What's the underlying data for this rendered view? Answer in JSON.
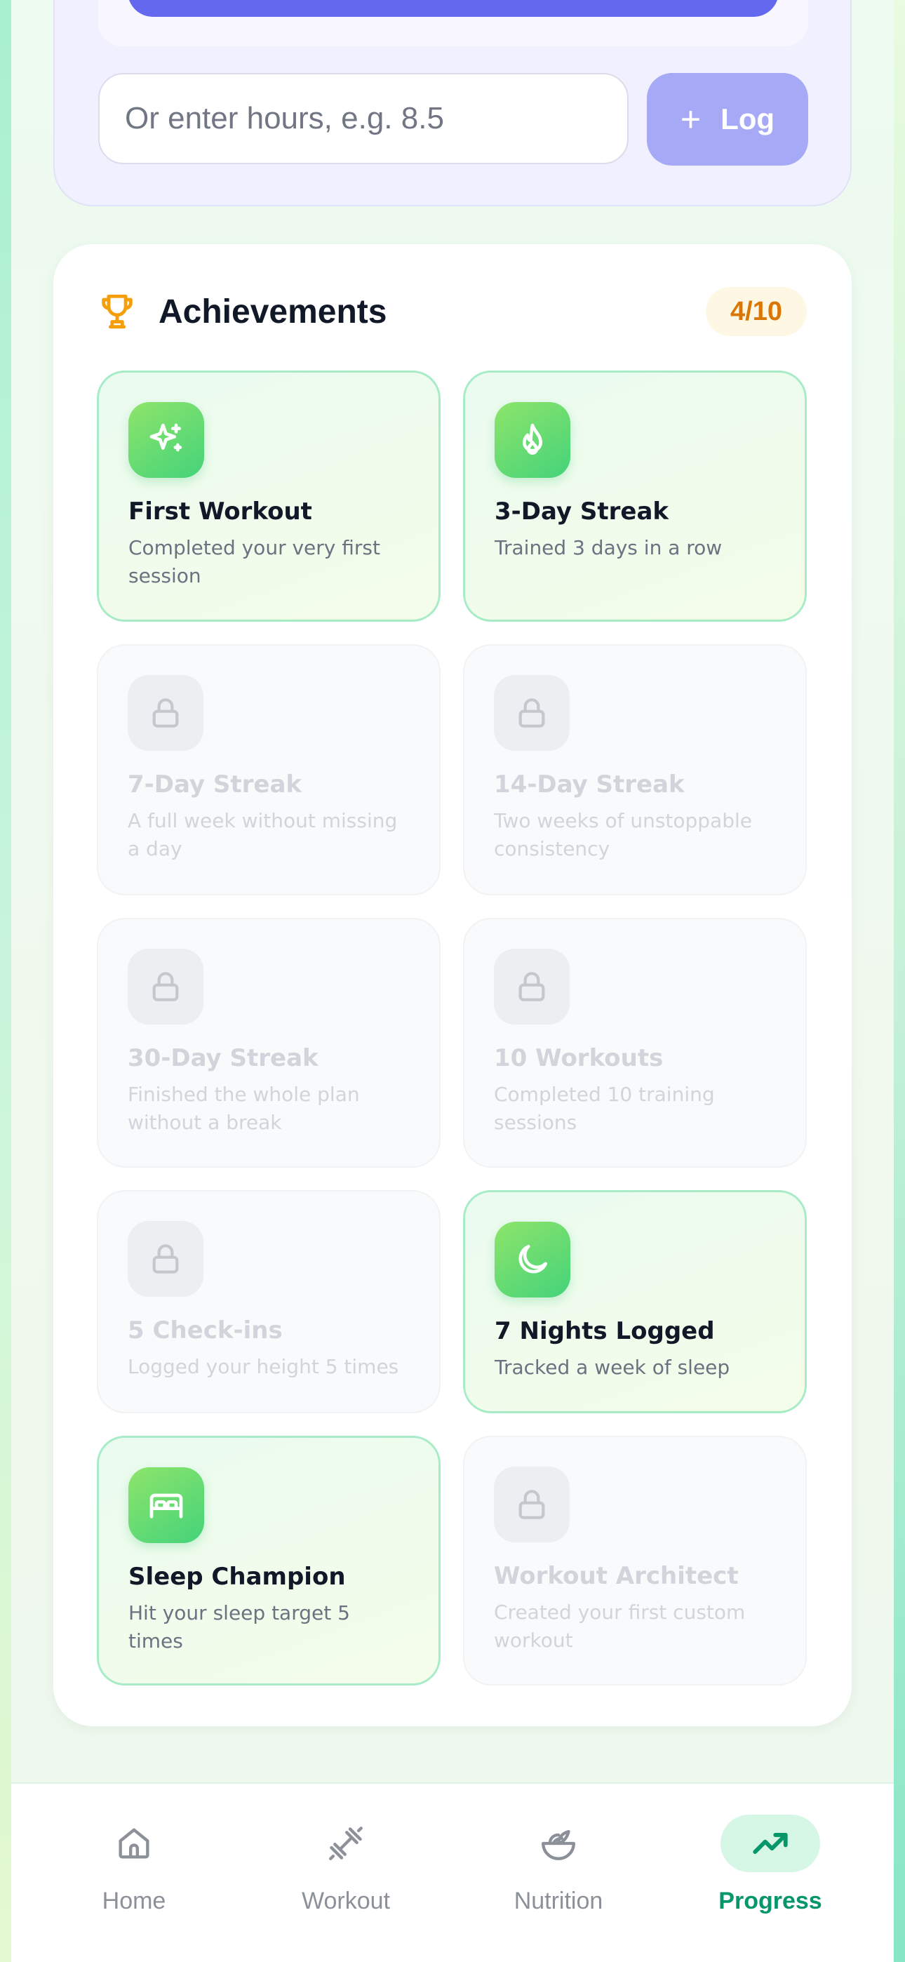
{
  "sleep": {
    "hours_placeholder": "Or enter hours, e.g. 8.5",
    "log_plus": "+",
    "log_label": "Log"
  },
  "achievements": {
    "title": "Achievements",
    "count": "4/10",
    "items": [
      {
        "name": "First Workout",
        "desc": "Completed your very first session",
        "earned": true,
        "icon": "sparkles-icon"
      },
      {
        "name": "3-Day Streak",
        "desc": "Trained 3 days in a row",
        "earned": true,
        "icon": "flame-icon"
      },
      {
        "name": "7-Day Streak",
        "desc": "A full week without missing a day",
        "earned": false,
        "icon": "lock-icon"
      },
      {
        "name": "14-Day Streak",
        "desc": "Two weeks of unstoppable consistency",
        "earned": false,
        "icon": "lock-icon"
      },
      {
        "name": "30-Day Streak",
        "desc": "Finished the whole plan without a break",
        "earned": false,
        "icon": "lock-icon"
      },
      {
        "name": "10 Workouts",
        "desc": "Completed 10 training sessions",
        "earned": false,
        "icon": "lock-icon"
      },
      {
        "name": "5 Check-ins",
        "desc": "Logged your height 5 times",
        "earned": false,
        "icon": "lock-icon"
      },
      {
        "name": "7 Nights Logged",
        "desc": "Tracked a week of sleep",
        "earned": true,
        "icon": "moon-icon"
      },
      {
        "name": "Sleep Champion",
        "desc": "Hit your sleep target 5 times",
        "earned": true,
        "icon": "bed-icon"
      },
      {
        "name": "Workout Architect",
        "desc": "Created your first custom workout",
        "earned": false,
        "icon": "lock-icon"
      }
    ]
  },
  "nav": {
    "home": "Home",
    "workout": "Workout",
    "nutrition": "Nutrition",
    "progress": "Progress",
    "active": "progress"
  },
  "colors": {
    "accent_green": "#059669",
    "accent_indigo": "#6468ee",
    "badge_amber": "#d97706"
  }
}
